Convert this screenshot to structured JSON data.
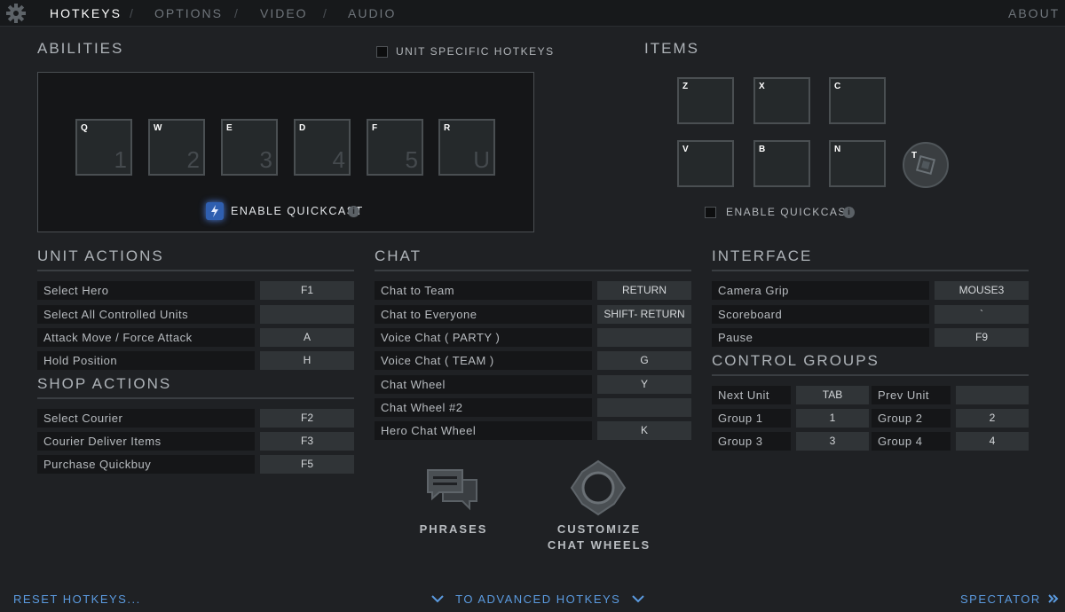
{
  "nav": {
    "tabs": [
      "HOTKEYS",
      "OPTIONS",
      "VIDEO",
      "AUDIO"
    ],
    "separator": "/",
    "about": "ABOUT"
  },
  "abilities": {
    "title": "ABILITIES",
    "unit_specific_label": "UNIT SPECIFIC HOTKEYS",
    "slots": [
      {
        "key": "Q",
        "num": "1"
      },
      {
        "key": "W",
        "num": "2"
      },
      {
        "key": "E",
        "num": "3"
      },
      {
        "key": "D",
        "num": "4"
      },
      {
        "key": "F",
        "num": "5"
      },
      {
        "key": "R",
        "num": "U"
      }
    ],
    "quickcast_label": "ENABLE QUICKCAST",
    "info": "i"
  },
  "items": {
    "title": "ITEMS",
    "slots": [
      "Z",
      "X",
      "C",
      "V",
      "B",
      "N"
    ],
    "tp_key": "T",
    "quickcast_label": "ENABLE QUICKCAST",
    "info": "i"
  },
  "unit_actions": {
    "title": "UNIT ACTIONS",
    "rows": [
      {
        "label": "Select Hero",
        "key": "F1"
      },
      {
        "label": "Select All Controlled Units",
        "key": ""
      },
      {
        "label": "Attack Move / Force Attack",
        "key": "A"
      },
      {
        "label": "Hold Position",
        "key": "H"
      }
    ]
  },
  "shop_actions": {
    "title": "SHOP ACTIONS",
    "rows": [
      {
        "label": "Select Courier",
        "key": "F2"
      },
      {
        "label": "Courier Deliver Items",
        "key": "F3"
      },
      {
        "label": "Purchase Quickbuy",
        "key": "F5"
      }
    ]
  },
  "chat": {
    "title": "CHAT",
    "rows": [
      {
        "label": "Chat to Team",
        "key": "RETURN"
      },
      {
        "label": "Chat to Everyone",
        "key": "SHIFT- RETURN"
      },
      {
        "label": "Voice Chat ( PARTY )",
        "key": ""
      },
      {
        "label": "Voice Chat ( TEAM )",
        "key": "G"
      },
      {
        "label": "Chat Wheel",
        "key": "Y"
      },
      {
        "label": "Chat Wheel #2",
        "key": ""
      },
      {
        "label": "Hero Chat Wheel",
        "key": "K"
      }
    ]
  },
  "interface": {
    "title": "INTERFACE",
    "rows": [
      {
        "label": "Camera Grip",
        "key": "MOUSE3"
      },
      {
        "label": "Scoreboard",
        "key": "`"
      },
      {
        "label": "Pause",
        "key": "F9"
      }
    ]
  },
  "control_groups": {
    "title": "CONTROL GROUPS",
    "rows": [
      {
        "left_label": "Next Unit",
        "left_key": "TAB",
        "right_label": "Prev Unit",
        "right_key": ""
      },
      {
        "left_label": "Group 1",
        "left_key": "1",
        "right_label": "Group 2",
        "right_key": "2"
      },
      {
        "left_label": "Group 3",
        "left_key": "3",
        "right_label": "Group 4",
        "right_key": "4"
      }
    ]
  },
  "bottom": {
    "phrases": "PHRASES",
    "customize_line1": "CUSTOMIZE",
    "customize_line2": "CHAT WHEELS",
    "reset": "RESET HOTKEYS...",
    "advanced": "TO ADVANCED HOTKEYS",
    "spectator": "SPECTATOR"
  }
}
